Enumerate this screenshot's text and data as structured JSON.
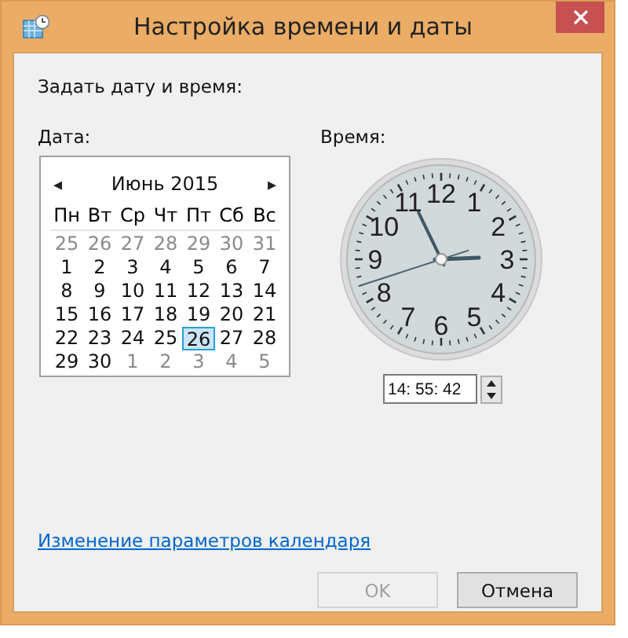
{
  "window": {
    "title": "Настройка времени и даты"
  },
  "heading": "Задать дату и время:",
  "date_label": "Дата:",
  "calendar": {
    "month": "Июнь 2015",
    "prev": "◂",
    "next": "▸",
    "weekdays": [
      "Пн",
      "Вт",
      "Ср",
      "Чт",
      "Пт",
      "Сб",
      "Вс"
    ],
    "weeks": [
      [
        {
          "day": "25",
          "kind": "other",
          "selected": false
        },
        {
          "day": "26",
          "kind": "other",
          "selected": false
        },
        {
          "day": "27",
          "kind": "other",
          "selected": false
        },
        {
          "day": "28",
          "kind": "other",
          "selected": false
        },
        {
          "day": "29",
          "kind": "other",
          "selected": false
        },
        {
          "day": "30",
          "kind": "other",
          "selected": false
        },
        {
          "day": "31",
          "kind": "other",
          "selected": false
        }
      ],
      [
        {
          "day": "1",
          "kind": "current",
          "selected": false
        },
        {
          "day": "2",
          "kind": "current",
          "selected": false
        },
        {
          "day": "3",
          "kind": "current",
          "selected": false
        },
        {
          "day": "4",
          "kind": "current",
          "selected": false
        },
        {
          "day": "5",
          "kind": "current",
          "selected": false
        },
        {
          "day": "6",
          "kind": "current",
          "selected": false
        },
        {
          "day": "7",
          "kind": "current",
          "selected": false
        }
      ],
      [
        {
          "day": "8",
          "kind": "current",
          "selected": false
        },
        {
          "day": "9",
          "kind": "current",
          "selected": false
        },
        {
          "day": "10",
          "kind": "current",
          "selected": false
        },
        {
          "day": "11",
          "kind": "current",
          "selected": false
        },
        {
          "day": "12",
          "kind": "current",
          "selected": false
        },
        {
          "day": "13",
          "kind": "current",
          "selected": false
        },
        {
          "day": "14",
          "kind": "current",
          "selected": false
        }
      ],
      [
        {
          "day": "15",
          "kind": "current",
          "selected": false
        },
        {
          "day": "16",
          "kind": "current",
          "selected": false
        },
        {
          "day": "17",
          "kind": "current",
          "selected": false
        },
        {
          "day": "18",
          "kind": "current",
          "selected": false
        },
        {
          "day": "19",
          "kind": "current",
          "selected": false
        },
        {
          "day": "20",
          "kind": "current",
          "selected": false
        },
        {
          "day": "21",
          "kind": "current",
          "selected": false
        }
      ],
      [
        {
          "day": "22",
          "kind": "current",
          "selected": false
        },
        {
          "day": "23",
          "kind": "current",
          "selected": false
        },
        {
          "day": "24",
          "kind": "current",
          "selected": false
        },
        {
          "day": "25",
          "kind": "current",
          "selected": false
        },
        {
          "day": "26",
          "kind": "current",
          "selected": true
        },
        {
          "day": "27",
          "kind": "current",
          "selected": false
        },
        {
          "day": "28",
          "kind": "current",
          "selected": false
        }
      ],
      [
        {
          "day": "29",
          "kind": "current",
          "selected": false
        },
        {
          "day": "30",
          "kind": "current",
          "selected": false
        },
        {
          "day": "1",
          "kind": "other",
          "selected": false
        },
        {
          "day": "2",
          "kind": "other",
          "selected": false
        },
        {
          "day": "3",
          "kind": "other",
          "selected": false
        },
        {
          "day": "4",
          "kind": "other",
          "selected": false
        },
        {
          "day": "5",
          "kind": "other",
          "selected": false
        }
      ]
    ]
  },
  "time_label": "Время:",
  "clock": {
    "numerals": [
      "12",
      "11",
      "1",
      "10",
      "2",
      "9",
      "3",
      "8",
      "4",
      "7",
      "5",
      "6"
    ]
  },
  "time_field": {
    "value": "14: 55: 42"
  },
  "link": "Изменение параметров календаря",
  "buttons": [
    {
      "label": "OK",
      "disabled": true
    },
    {
      "label": "Отмена",
      "disabled": false
    }
  ]
}
